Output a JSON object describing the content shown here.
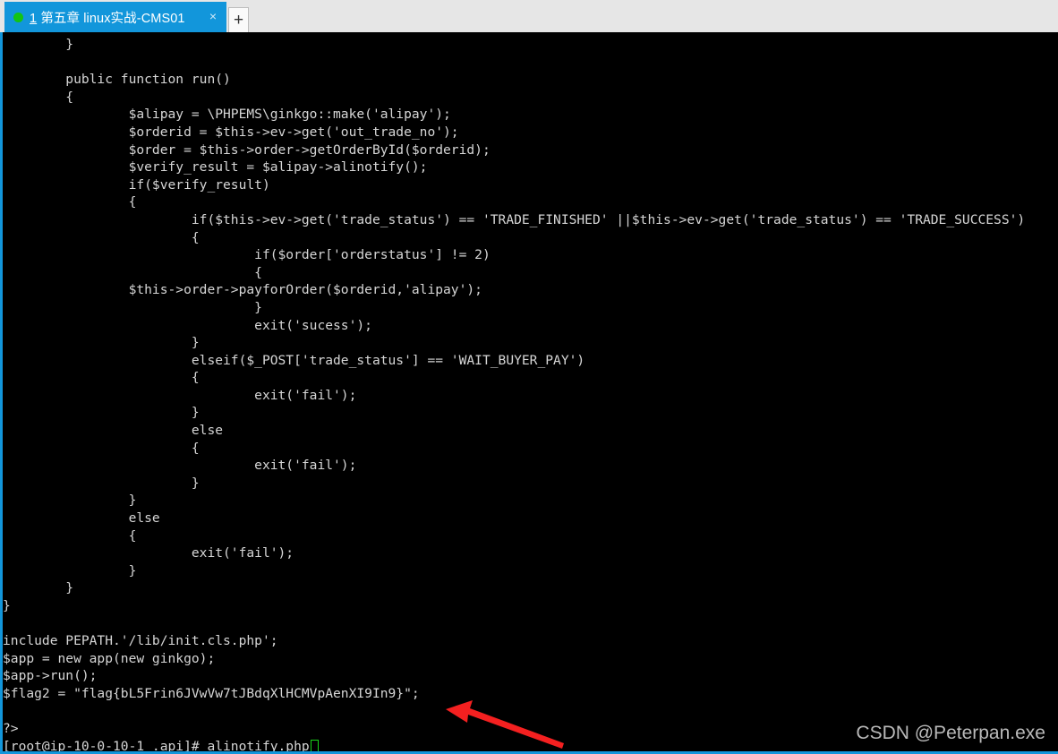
{
  "window": {
    "tab": {
      "index": "1",
      "title": "第五章 linux实战-CMS01",
      "close_label": "×",
      "new_tab_label": "+",
      "status_dot_color": "#13c413",
      "active_color": "#1296db"
    }
  },
  "terminal": {
    "background": "#000000",
    "foreground": "#d6d6d6",
    "cursor_color": "#19d519",
    "lines": [
      "        }",
      "",
      "        public function run()",
      "        {",
      "                $alipay = \\PHPEMS\\ginkgo::make('alipay');",
      "                $orderid = $this->ev->get('out_trade_no');",
      "                $order = $this->order->getOrderById($orderid);",
      "                $verify_result = $alipay->alinotify();",
      "                if($verify_result)",
      "                {",
      "                        if($this->ev->get('trade_status') == 'TRADE_FINISHED' ||$this->ev->get('trade_status') == 'TRADE_SUCCESS')",
      "                        {",
      "                                if($order['orderstatus'] != 2)",
      "                                {",
      "                $this->order->payforOrder($orderid,'alipay');",
      "                                }",
      "                                exit('sucess');",
      "                        }",
      "                        elseif($_POST['trade_status'] == 'WAIT_BUYER_PAY')",
      "                        {",
      "                                exit('fail');",
      "                        }",
      "                        else",
      "                        {",
      "                                exit('fail');",
      "                        }",
      "                }",
      "                else",
      "                {",
      "                        exit('fail');",
      "                }",
      "        }",
      "}",
      "",
      "include PEPATH.'/lib/init.cls.php';",
      "$app = new app(new ginkgo);",
      "$app->run();",
      "$flag2 = \"flag{bL5Frin6JVwVw7tJBdqXlHCMVpAenXI9In9}\";",
      "",
      "?>"
    ],
    "prompt": "[root@ip-10-0-10-1 .api]# alinotify.php",
    "flag_value": "flag{bL5Frin6JVwVw7tJBdqXlHCMVpAenXI9In9}"
  },
  "annotation": {
    "arrow_color": "#f42020",
    "points_at": "$flag2 line"
  },
  "watermark": {
    "text": "CSDN @Peterpan.exe"
  }
}
